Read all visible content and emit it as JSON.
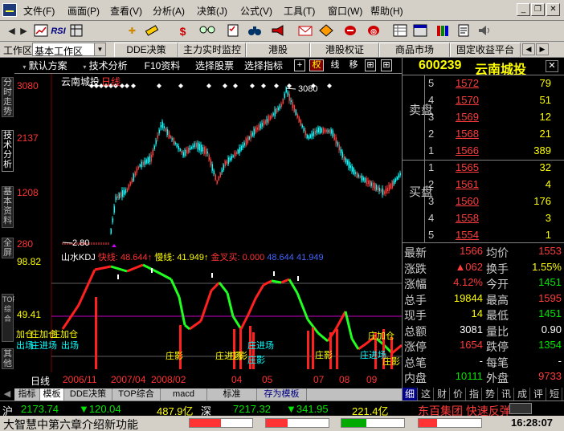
{
  "menubar": {
    "items": [
      "文件(F)",
      "画面(P)",
      "查看(V)",
      "分析(A)",
      "决策(J)",
      "公式(V)",
      "工具(T)",
      "窗口(W)",
      "帮助(H)"
    ]
  },
  "toolbar": {
    "icons": [
      "back-icon",
      "forward-icon",
      "chart-icon",
      "rsi-icon",
      "crosshair-icon",
      "ruler-icon",
      "dollar-icon",
      "glasses-icon",
      "checklist-icon",
      "binoculars-icon",
      "megaphone-icon",
      "mail-icon",
      "diamond-icon",
      "link-icon",
      "magnet-icon",
      "grid-icon",
      "table-icon",
      "books-icon",
      "report-icon",
      "speaker-icon"
    ],
    "rsi_label": "RSI",
    "dollar_label": "$"
  },
  "tabbar": {
    "workspace_label": "工作区",
    "workspace_value": "基本工作区",
    "tabs": [
      "DDE决策",
      "主力实时监控",
      "港股",
      "港股权证",
      "商品市场",
      "固定收益平台"
    ]
  },
  "chart_header": {
    "buttons": [
      "默认方案",
      "技术分析",
      "F10资料",
      "选择股票",
      "选择指标"
    ],
    "toggles": [
      "+",
      "权",
      "线",
      "移",
      "⊞",
      "⊞"
    ],
    "active_toggle": "权"
  },
  "left_tabs": [
    "分时走势",
    "技术分析",
    "基本资料",
    "全屏",
    "TOP综合",
    "其他"
  ],
  "active_left_tab": "技术分析",
  "main_chart": {
    "stock_label": "云南城投",
    "period_label": "日线",
    "high_marker": "3080",
    "low_marker": "2.80",
    "y_ticks": [
      "3080",
      "2137",
      "1208",
      "280"
    ]
  },
  "indicator": {
    "name": "山水KDJ",
    "fast_label": "快线:",
    "fast_value": "48.644",
    "slow_label": "慢线:",
    "slow_value": "41.949",
    "cross_label": "金叉买:",
    "cross_value": "0.000",
    "v4": "48.644",
    "v5": "41.949",
    "y_ticks": [
      "98.82",
      "49.41"
    ],
    "signals": [
      "加仓",
      "庄加仓",
      "庄加仓",
      "出场",
      "庄进场",
      "出场",
      "庄影",
      "庄进场",
      "庄影",
      "庄进场",
      "庄影",
      "庄影",
      "庄进场",
      "庄加仓",
      "庄影"
    ]
  },
  "date_axis": {
    "period_label": "日线",
    "labels": [
      "2006/11",
      "2007/04",
      "2008/02",
      "04",
      "05",
      "07",
      "08",
      "09"
    ]
  },
  "bottom_tabs": [
    "指标",
    "模板",
    "DDE决策",
    "TOP综合",
    "macd",
    "标准",
    "存为模板"
  ],
  "active_bottom_tab": "模板",
  "quote": {
    "code": "600239",
    "name": "云南城投",
    "sell_label": "卖盘",
    "buy_label": "买盘",
    "sell": [
      {
        "level": "5",
        "price": "1572",
        "vol": "79"
      },
      {
        "level": "4",
        "price": "1570",
        "vol": "51"
      },
      {
        "level": "3",
        "price": "1569",
        "vol": "12"
      },
      {
        "level": "2",
        "price": "1568",
        "vol": "21"
      },
      {
        "level": "1",
        "price": "1566",
        "vol": "389"
      }
    ],
    "buy": [
      {
        "level": "1",
        "price": "1565",
        "vol": "32"
      },
      {
        "level": "2",
        "price": "1561",
        "vol": "4"
      },
      {
        "level": "3",
        "price": "1560",
        "vol": "176"
      },
      {
        "level": "4",
        "price": "1558",
        "vol": "3"
      },
      {
        "level": "5",
        "price": "1554",
        "vol": "1"
      }
    ],
    "stats": [
      {
        "l": "最新",
        "lv": "1566",
        "r": "均价",
        "rv": "1553"
      },
      {
        "l": "涨跌",
        "lv": "▲062",
        "r": "换手",
        "rv": "1.55%"
      },
      {
        "l": "涨幅",
        "lv": "4.12%",
        "r": "今开",
        "rv": "1451"
      },
      {
        "l": "总手",
        "lv": "19844",
        "r": "最高",
        "rv": "1595"
      },
      {
        "l": "现手",
        "lv": "14",
        "r": "最低",
        "rv": "1451"
      },
      {
        "l": "总额",
        "lv": "3081",
        "r": "量比",
        "rv": "0.90"
      },
      {
        "l": "涨停",
        "lv": "1654",
        "r": "跌停",
        "rv": "1354"
      },
      {
        "l": "总笔",
        "lv": "-",
        "r": "每笔",
        "rv": "-"
      },
      {
        "l": "内盘",
        "lv": "10111",
        "r": "外盘",
        "rv": "9733"
      }
    ],
    "tabs": [
      "细",
      "这",
      "财",
      "价",
      "指",
      "势",
      "讯",
      "成",
      "评",
      "短"
    ]
  },
  "statusbar": {
    "sh_label": "沪",
    "sh_index": "2173.74",
    "sh_change": "▼120.04",
    "sh_amount": "487.9亿",
    "sz_label": "深",
    "sz_index": "7217.32",
    "sz_change": "▼341.95",
    "sz_amount": "221.4亿",
    "news": "东百集团 快速反弹"
  },
  "marquee": {
    "text": "大智慧中第六章介绍新功能",
    "time": "16:28:07"
  },
  "colors": {
    "up": "#ff3c3c",
    "down": "#00e600",
    "up_candle": "#ff3c3c",
    "down_candle": "#00ffff",
    "accent_yellow": "#ffff00",
    "fast_line_red": "#ff2020",
    "slow_line_green": "#20ff20"
  }
}
